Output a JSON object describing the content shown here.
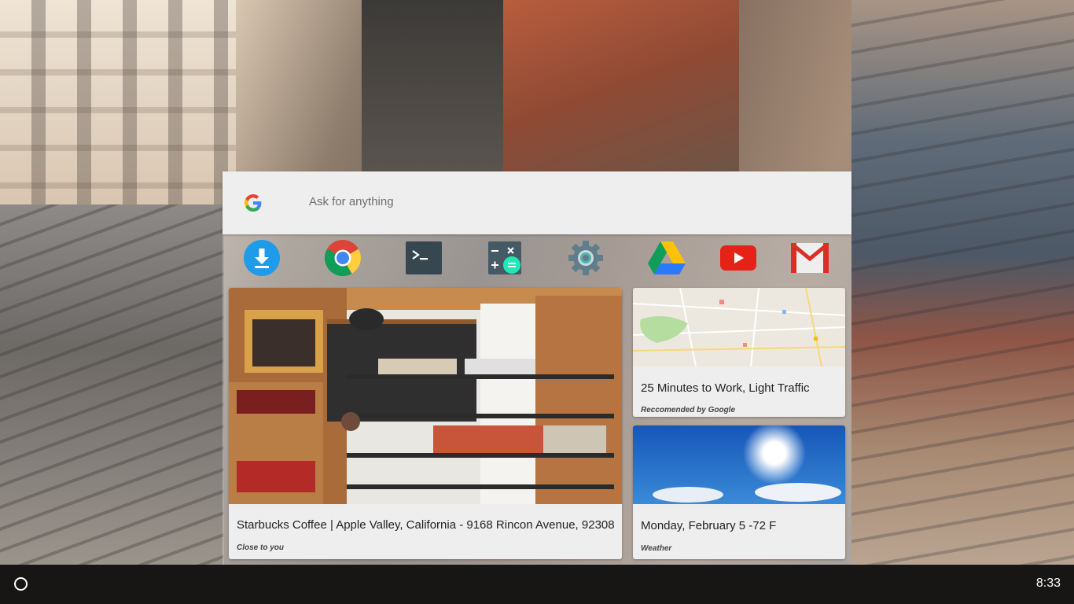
{
  "search": {
    "placeholder": "Ask for anything",
    "logo_icon": "google-g-icon"
  },
  "apps": [
    {
      "name": "Downloads",
      "icon": "download-icon"
    },
    {
      "name": "Chrome",
      "icon": "chrome-icon"
    },
    {
      "name": "Terminal",
      "icon": "terminal-icon"
    },
    {
      "name": "Calculator",
      "icon": "calculator-icon"
    },
    {
      "name": "Settings",
      "icon": "settings-gear-icon"
    },
    {
      "name": "Google Drive",
      "icon": "drive-icon"
    },
    {
      "name": "YouTube",
      "icon": "youtube-icon"
    },
    {
      "name": "Gmail",
      "icon": "gmail-icon"
    }
  ],
  "cards": {
    "place": {
      "title": "Starbucks Coffee | Apple Valley, California - 9168 Rincon Avenue, 92308",
      "subtitle": "Close to you"
    },
    "traffic": {
      "title": "25 Minutes to Work, Light Traffic",
      "subtitle": "Reccomended by Google"
    },
    "weather": {
      "title": "Monday, February 5 -72 F",
      "subtitle": "Weather"
    }
  },
  "shelf": {
    "clock": "8:33",
    "launcher_icon": "launcher-circle-icon"
  },
  "colors": {
    "accent_blue": "#1e88e5",
    "youtube_red": "#e62117",
    "gmail_red": "#d93025"
  }
}
